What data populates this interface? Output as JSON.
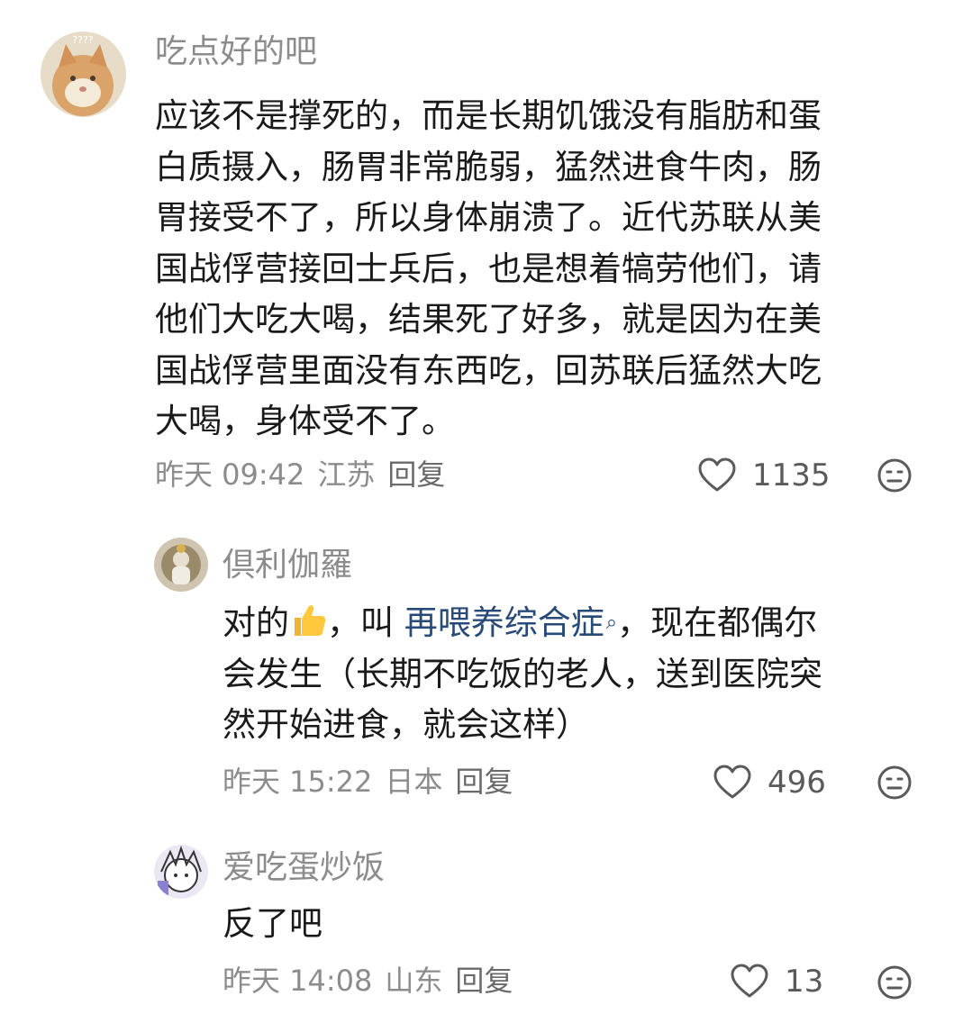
{
  "comments": [
    {
      "username": "吃点好的吧",
      "lines": [
        "应该不是撑死的，而是长期饥饿没有脂肪和蛋",
        "白质摄入，肠胃非常脆弱，猛然进食牛肉，肠",
        "胃接受不了，所以身体崩溃了。近代苏联从美",
        "国战俘营接回士兵后，也是想着犒劳他们，请",
        "他们大吃大喝，结果死了好多，就是因为在美",
        "国战俘营里面没有东西吃，回苏联后猛然大吃",
        "大喝，身体受不了。"
      ],
      "time": "昨天 09:42",
      "location": "江苏",
      "reply_label": "回复",
      "likes": "1135",
      "avatar_text": "????"
    },
    {
      "username": "倶利伽羅",
      "line1_prefix": "对的",
      "line1_middle": "，叫 ",
      "link_text": "再喂养综合症",
      "line1_suffix": "，现在都偶尔",
      "lines": [
        "会发生（长期不吃饭的老人，送到医院突",
        "然开始进食，就会这样）"
      ],
      "time": "昨天 15:22",
      "location": "日本",
      "reply_label": "回复",
      "likes": "496"
    },
    {
      "username": "爱吃蛋炒饭",
      "lines": [
        "反了吧"
      ],
      "time": "昨天 14:08",
      "location": "山东",
      "reply_label": "回复",
      "likes": "13"
    }
  ],
  "icons": {
    "like": "heart-outline-icon",
    "reaction": "neutral-face-icon",
    "thumbs": "thumbs-up-emoji",
    "search": "search-icon"
  },
  "colors": {
    "link": "#284a78",
    "meta": "#8c8c8c",
    "text": "#1a1a1a"
  }
}
